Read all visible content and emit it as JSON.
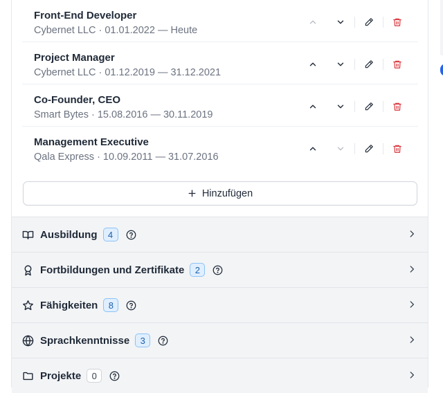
{
  "entries": [
    {
      "title": "Front-End Developer",
      "subtitle": "Cybernet LLC · 01.01.2022 — Heute",
      "up_enabled": false,
      "down_enabled": true
    },
    {
      "title": "Project Manager",
      "subtitle": "Cybernet LLC · 01.12.2019 — 31.12.2021",
      "up_enabled": true,
      "down_enabled": true
    },
    {
      "title": "Co-Founder, CEO",
      "subtitle": "Smart Bytes · 15.08.2016 — 30.11.2019",
      "up_enabled": true,
      "down_enabled": true
    },
    {
      "title": "Management Executive",
      "subtitle": "Qala Express · 10.09.2011 — 31.07.2016",
      "up_enabled": true,
      "down_enabled": false
    }
  ],
  "add_button": {
    "label": "Hinzufügen",
    "icon": "plus-icon"
  },
  "sections": [
    {
      "label": "Ausbildung",
      "count": "4",
      "icon": "book-icon",
      "badge_style": "blue"
    },
    {
      "label": "Fortbildungen und Zertifikate",
      "count": "2",
      "icon": "award-icon",
      "badge_style": "blue"
    },
    {
      "label": "Fähigkeiten",
      "count": "8",
      "icon": "star-icon",
      "badge_style": "blue"
    },
    {
      "label": "Sprachkenntnisse",
      "count": "3",
      "icon": "globe-icon",
      "badge_style": "blue"
    },
    {
      "label": "Projekte",
      "count": "0",
      "icon": "folder-icon",
      "badge_style": "gray"
    }
  ],
  "colors": {
    "delete": "#d9363e",
    "badge_blue_bg": "#e0efff",
    "badge_blue_border": "#8cc2f5",
    "section_bg": "#f3f4f6"
  }
}
